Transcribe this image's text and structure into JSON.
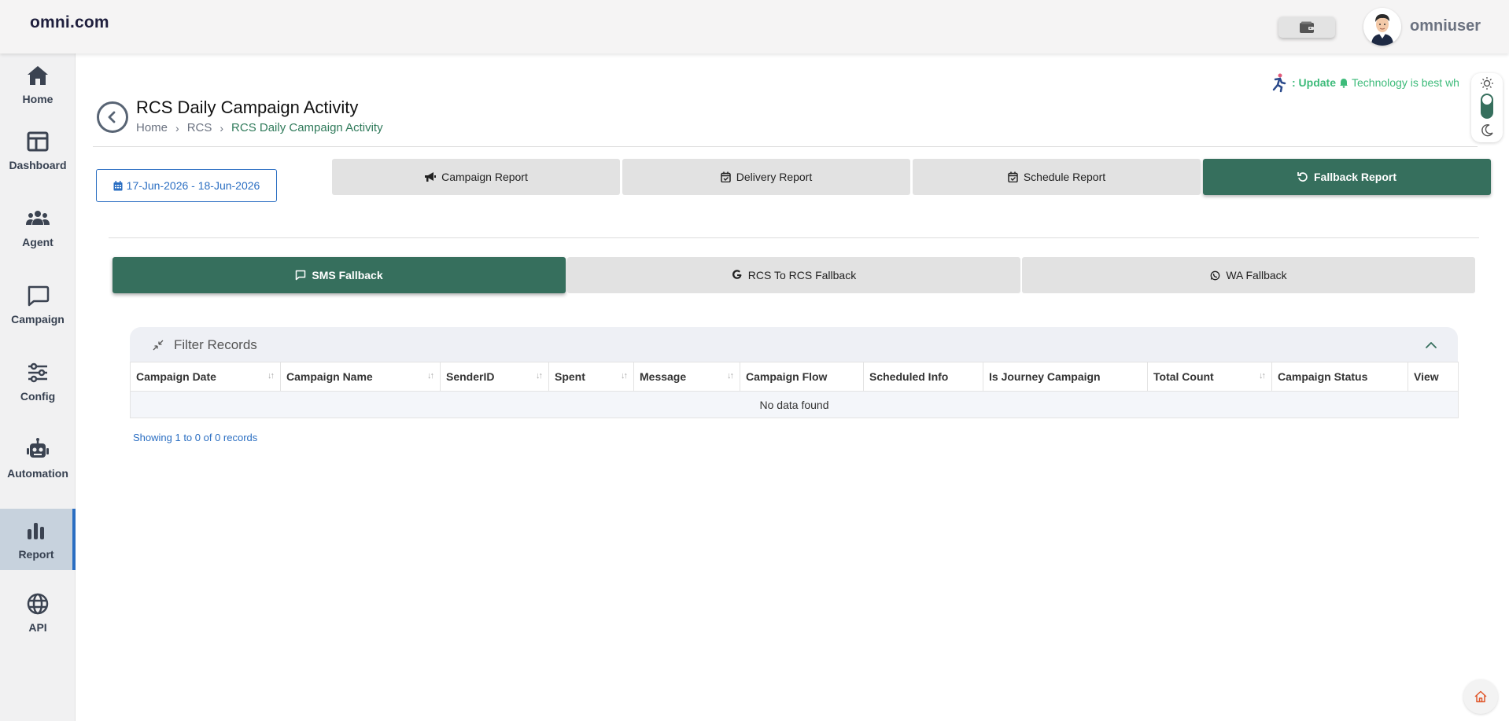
{
  "header": {
    "logo": "omni.com",
    "username": "omniuser"
  },
  "sidebar": {
    "items": [
      {
        "label": "Home",
        "icon": "home-icon"
      },
      {
        "label": "Dashboard",
        "icon": "dashboard-icon"
      },
      {
        "label": "Agent",
        "icon": "users-icon"
      },
      {
        "label": "Campaign",
        "icon": "chat-icon"
      },
      {
        "label": "Config",
        "icon": "sliders-icon"
      },
      {
        "label": "Automation",
        "icon": "robot-icon"
      },
      {
        "label": "Report",
        "icon": "bar-chart-icon",
        "active": true
      },
      {
        "label": "API",
        "icon": "globe-icon"
      }
    ]
  },
  "ticker": {
    "prefix": ": Update",
    "text": "Technology is best wh"
  },
  "page": {
    "title": "RCS Daily Campaign Activity",
    "breadcrumb": [
      "Home",
      "RCS",
      "RCS Daily Campaign Activity"
    ],
    "date_range": "17-Jun-2026 - 18-Jun-2026"
  },
  "report_tabs": [
    {
      "label": "Campaign Report",
      "icon": "bullhorn-icon"
    },
    {
      "label": "Delivery Report",
      "icon": "calendar-check-icon"
    },
    {
      "label": "Schedule Report",
      "icon": "calendar-check-icon"
    },
    {
      "label": "Fallback Report",
      "icon": "refresh-icon",
      "active": true
    }
  ],
  "fallback_tabs": [
    {
      "label": "SMS Fallback",
      "icon": "message-icon",
      "active": true
    },
    {
      "label": "RCS To RCS Fallback",
      "icon": "google-icon"
    },
    {
      "label": "WA Fallback",
      "icon": "whatsapp-icon"
    }
  ],
  "filter": {
    "title": "Filter Records"
  },
  "table": {
    "columns": [
      "Campaign Date",
      "Campaign Name",
      "SenderID",
      "Spent",
      "Message",
      "Campaign Flow",
      "Scheduled Info",
      "Is Journey Campaign",
      "Total Count",
      "Campaign Status",
      "View"
    ],
    "empty_text": "No data found",
    "showing": "Showing 1 to 0 of 0 records"
  },
  "colors": {
    "accent_green": "#366f5d",
    "link_blue": "#2a6ec2",
    "ticker_green": "#3dbb7a"
  }
}
